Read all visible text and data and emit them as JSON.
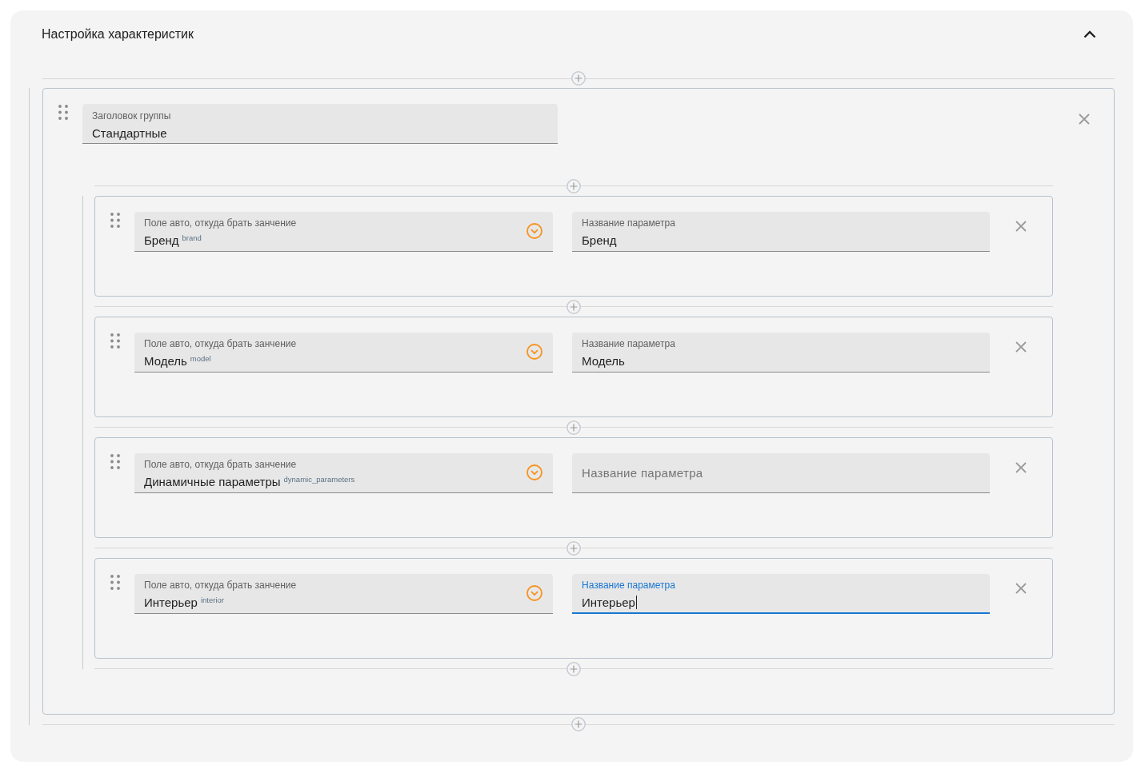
{
  "panel": {
    "title": "Настройка характеристик",
    "expanded": true
  },
  "groups": [
    {
      "title_field": {
        "label": "Заголовок группы",
        "value": "Стандартные"
      },
      "items": [
        {
          "source_field": {
            "label": "Поле авто, откуда брать занчение",
            "value": "Бренд",
            "code": "brand"
          },
          "name_field": {
            "label": "Название параметра",
            "value": "Бренд",
            "focused": false
          }
        },
        {
          "source_field": {
            "label": "Поле авто, откуда брать занчение",
            "value": "Модель",
            "code": "model"
          },
          "name_field": {
            "label": "Название параметра",
            "value": "Модель",
            "focused": false
          }
        },
        {
          "source_field": {
            "label": "Поле авто, откуда брать занчение",
            "value": "Динамичные параметры",
            "code": "dynamic_parameters"
          },
          "name_field": {
            "placeholder": "Название параметра",
            "focused": false
          }
        },
        {
          "source_field": {
            "label": "Поле авто, откуда брать занчение",
            "value": "Интерьер",
            "code": "interior"
          },
          "name_field": {
            "label": "Название параметра",
            "value": "Интерьер",
            "focused": true
          }
        }
      ]
    }
  ]
}
